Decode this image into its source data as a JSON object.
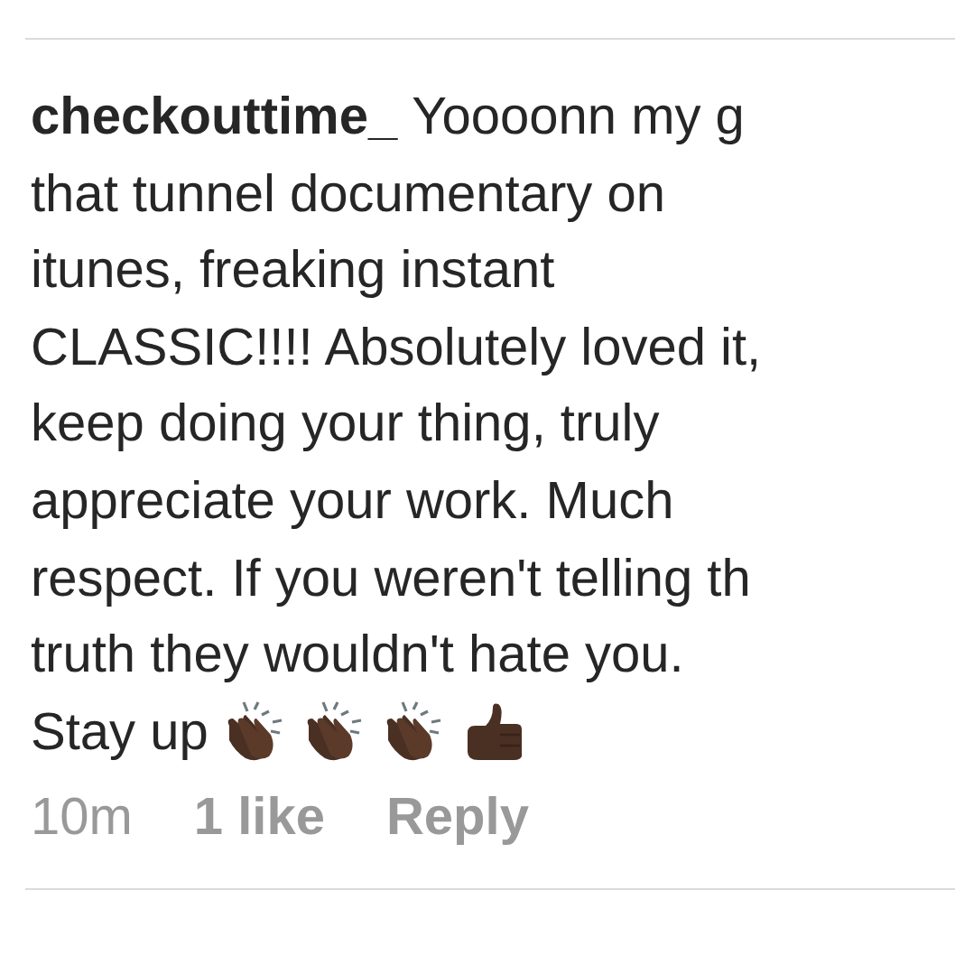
{
  "comment": {
    "username": "checkouttime_",
    "lines": [
      "Yoooonn my g",
      "that tunnel documentary on",
      "itunes, freaking instant",
      "CLASSIC!!!! Absolutely loved it,",
      "keep doing your thing, truly",
      "appreciate your work. Much",
      "respect. If you weren't telling th",
      "truth they wouldn't hate you.",
      "Stay up"
    ],
    "reactions": [
      {
        "kind": "clap"
      },
      {
        "kind": "clap"
      },
      {
        "kind": "clap"
      },
      {
        "kind": "thumbs_up"
      }
    ],
    "time": "10m",
    "likes": "1 like",
    "reply": "Reply"
  }
}
